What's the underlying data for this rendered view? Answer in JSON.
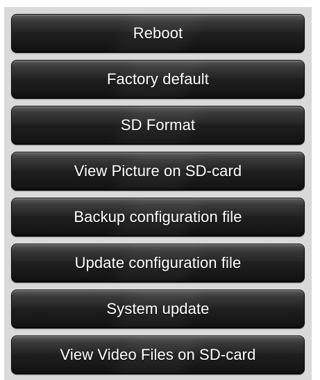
{
  "menu": {
    "buttons": [
      {
        "label": "Reboot"
      },
      {
        "label": "Factory default"
      },
      {
        "label": "SD Format"
      },
      {
        "label": "View Picture on SD-card"
      },
      {
        "label": "Backup configuration file"
      },
      {
        "label": "Update configuration file"
      },
      {
        "label": "System update"
      },
      {
        "label": "View Video Files on SD-card"
      }
    ]
  },
  "colors": {
    "panel_background": "#d9d9d9",
    "button_background": "#1f1f1f",
    "button_text": "#ffffff"
  }
}
